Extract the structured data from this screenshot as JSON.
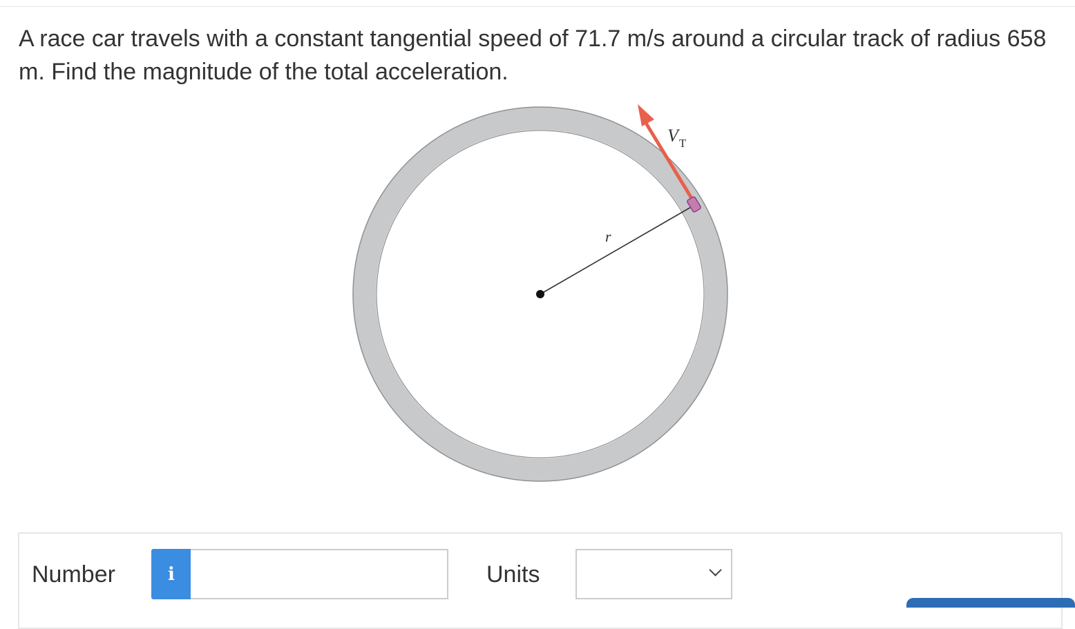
{
  "question": {
    "text": "A race car travels with a constant tangential speed of 71.7 m/s around a circular track of radius 658 m. Find the magnitude of the total acceleration."
  },
  "figure": {
    "velocity_label": "V",
    "velocity_subscript": "T",
    "radius_label": "r",
    "colors": {
      "track": "#c8c9cb",
      "track_outline": "#8f9093",
      "arrow": "#e8604c",
      "car": "#b86aa8"
    }
  },
  "answer": {
    "number_label": "Number",
    "info_icon_glyph": "i",
    "number_value": "",
    "units_label": "Units",
    "units_selected": "",
    "accent_color": "#3a8de0"
  }
}
